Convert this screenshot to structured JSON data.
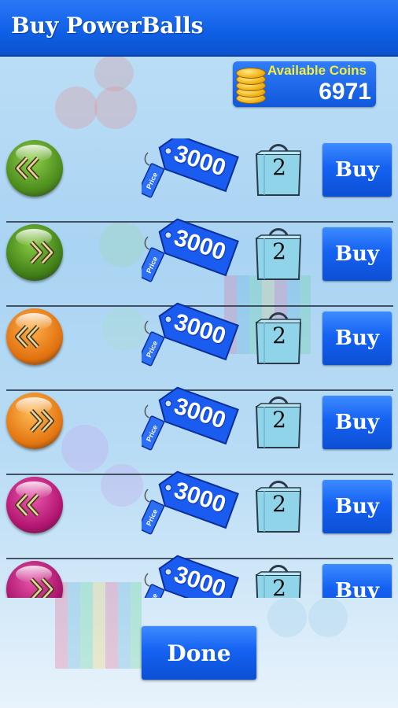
{
  "header": {
    "title": "Buy PowerBalls"
  },
  "coins": {
    "label": "Available Coins",
    "value": "6971",
    "icon": "coin-stack-icon"
  },
  "items": [
    {
      "ball_color": "#4a8a1c",
      "ball_highlight": "#8fd14a",
      "direction": "left",
      "price": "3000",
      "tag_small_text": "Price",
      "quantity": "2",
      "button_label": "Buy"
    },
    {
      "ball_color": "#3f7e16",
      "ball_highlight": "#86c943",
      "direction": "right",
      "price": "3000",
      "tag_small_text": "Price",
      "quantity": "2",
      "button_label": "Buy"
    },
    {
      "ball_color": "#e0700e",
      "ball_highlight": "#ffb14a",
      "direction": "left",
      "price": "3000",
      "tag_small_text": "Price",
      "quantity": "2",
      "button_label": "Buy"
    },
    {
      "ball_color": "#e37510",
      "ball_highlight": "#ffba55",
      "direction": "right",
      "price": "3000",
      "tag_small_text": "Price",
      "quantity": "2",
      "button_label": "Buy"
    },
    {
      "ball_color": "#b0136f",
      "ball_highlight": "#ec5ab0",
      "direction": "left",
      "price": "3000",
      "tag_small_text": "Price",
      "quantity": "2",
      "button_label": "Buy"
    },
    {
      "ball_color": "#a8126a",
      "ball_highlight": "#e854aa",
      "direction": "right",
      "price": "3000",
      "tag_small_text": "Price",
      "quantity": "2",
      "button_label": "Buy"
    }
  ],
  "footer": {
    "done_label": "Done"
  },
  "colors": {
    "accent": "#1562f2",
    "coins_label": "#f6ee3d",
    "tag_blue": "#1a5cf0",
    "bag_fill": "#8fd4e8"
  }
}
